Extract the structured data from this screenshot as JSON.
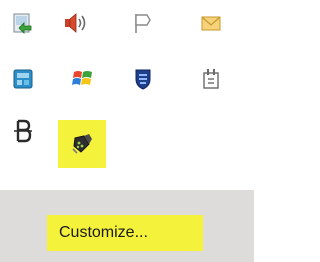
{
  "window": {
    "title": ""
  },
  "icons": [
    {
      "name": "safely-remove-hardware-icon",
      "row": 0,
      "col": 0,
      "highlighted": false
    },
    {
      "name": "volume-icon",
      "row": 0,
      "col": 1,
      "highlighted": false
    },
    {
      "name": "action-center-flag-icon",
      "row": 0,
      "col": 2,
      "highlighted": false
    },
    {
      "name": "mail-envelope-icon",
      "row": 0,
      "col": 3,
      "highlighted": false
    },
    {
      "name": "app-window-icon",
      "row": 1,
      "col": 0,
      "highlighted": false
    },
    {
      "name": "windows-logo-icon",
      "row": 1,
      "col": 1,
      "highlighted": false
    },
    {
      "name": "security-shield-icon",
      "row": 1,
      "col": 2,
      "highlighted": false
    },
    {
      "name": "power-plug-icon",
      "row": 1,
      "col": 3,
      "highlighted": false
    },
    {
      "name": "bluetooth-b-icon",
      "row": 2,
      "col": 0,
      "highlighted": false
    },
    {
      "name": "usb-device-icon",
      "row": 2,
      "col": 1,
      "highlighted": true
    }
  ],
  "customize": {
    "label": "Customize..."
  },
  "colors": {
    "highlight": "#f4f23a",
    "panel_bg": "#ffffff",
    "bar_bg": "#dedcda"
  }
}
